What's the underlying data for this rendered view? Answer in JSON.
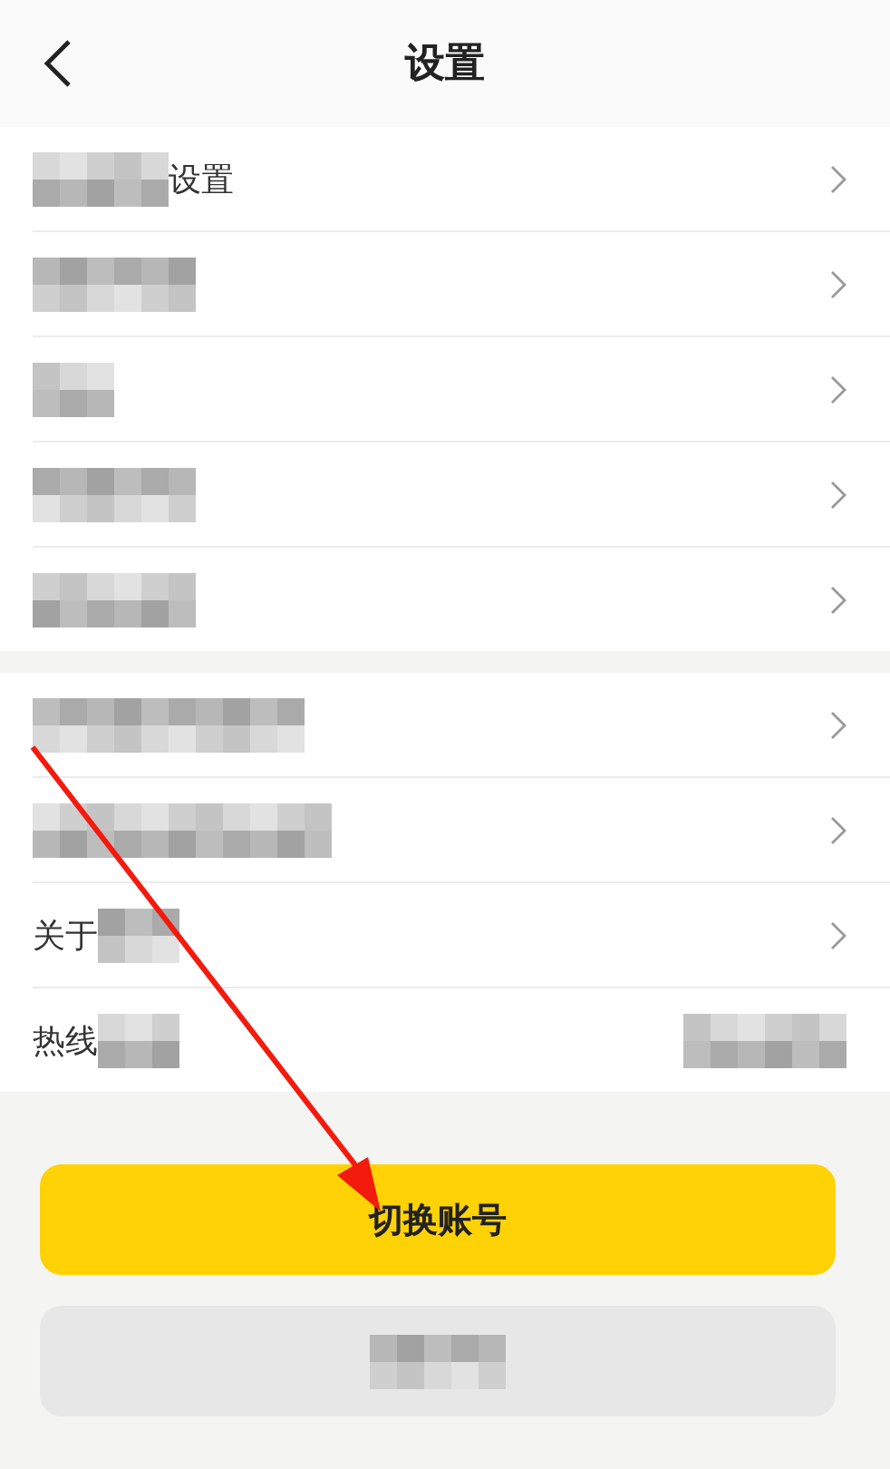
{
  "header": {
    "title": "设置"
  },
  "groups": [
    [
      {
        "label": "设置",
        "chevron": true
      },
      {
        "chevron": true
      },
      {
        "chevron": true
      },
      {
        "chevron": true
      },
      {
        "chevron": true
      }
    ],
    [
      {
        "chevron": true
      },
      {
        "chevron": true
      },
      {
        "label": "关于",
        "chevron": true
      },
      {
        "label": "热线",
        "chevron": false
      }
    ]
  ],
  "buttons": [
    {
      "label": "切换账号",
      "kind": "primary"
    },
    {
      "kind": "secondary"
    }
  ]
}
